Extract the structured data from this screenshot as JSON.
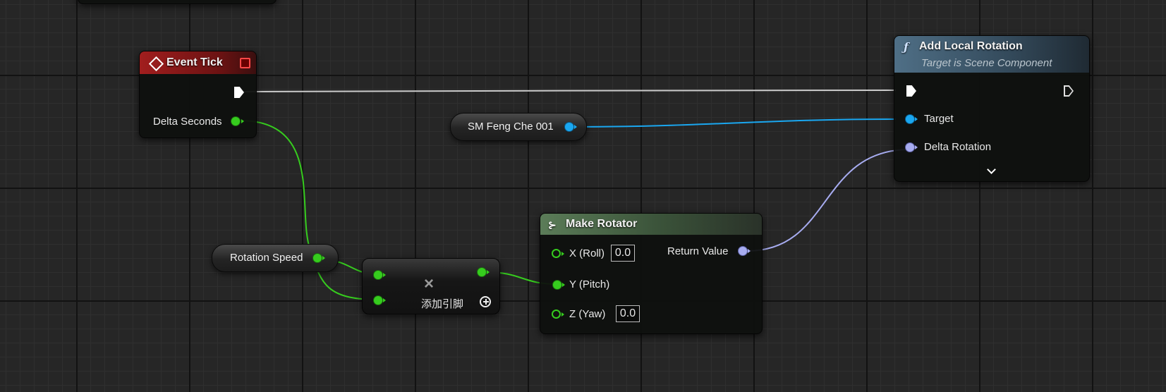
{
  "colors": {
    "event_header": "#a11e1e",
    "function_header": "#4f6f86",
    "pure_header": "#5b7c58",
    "float_pin": "#36cc1e",
    "object_pin": "#1aa7f0",
    "rotator_pin": "#a7acf0",
    "exec_wire": "#cccccc"
  },
  "event_tick": {
    "title": "Event Tick",
    "header_icon": "event-diamond-icon",
    "delta_seconds": "Delta Seconds"
  },
  "add_local_rotation": {
    "title": "Add Local Rotation",
    "subtitle": "Target is Scene Component",
    "function_icon": "ƒ",
    "target": "Target",
    "delta_rotation": "Delta Rotation",
    "expand_icon": "chevron-down-icon"
  },
  "sm_variable": {
    "label": "SM Feng Che 001"
  },
  "rotation_speed_variable": {
    "label": "Rotation Speed"
  },
  "multiply_node": {
    "operator": "×",
    "add_pin": "添加引脚",
    "add_icon": "plus-circle-icon"
  },
  "make_rotator": {
    "title": "Make Rotator",
    "x_label": "X (Roll)",
    "x_value": "0.0",
    "y_label": "Y (Pitch)",
    "z_label": "Z (Yaw)",
    "z_value": "0.0",
    "return_label": "Return Value"
  }
}
